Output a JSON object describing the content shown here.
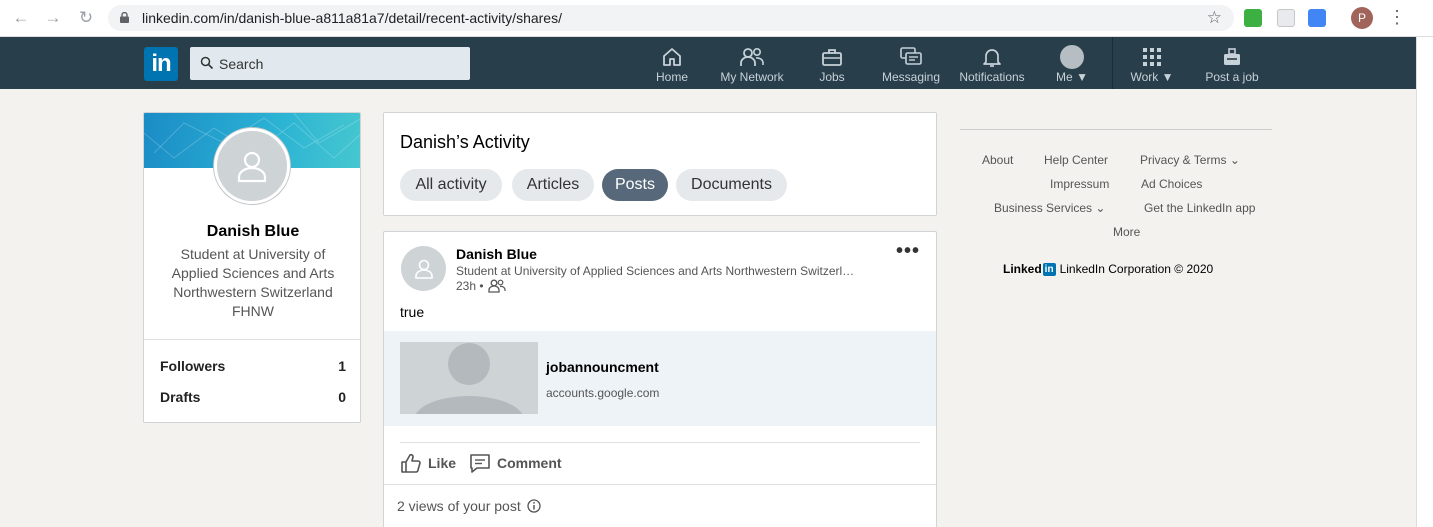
{
  "browser": {
    "url": "linkedin.com/in/danish-blue-a811a81a7/detail/recent-activity/shares/",
    "profile_initial": "P"
  },
  "header": {
    "logo": "in",
    "search_placeholder": "Search",
    "nav": [
      {
        "label": "Home",
        "icon": "home-icon"
      },
      {
        "label": "My Network",
        "icon": "network-icon"
      },
      {
        "label": "Jobs",
        "icon": "briefcase-icon"
      },
      {
        "label": "Messaging",
        "icon": "messaging-icon"
      },
      {
        "label": "Notifications",
        "icon": "bell-icon"
      },
      {
        "label": "Me",
        "icon": "avatar-icon"
      },
      {
        "label": "Work",
        "icon": "grid-icon"
      },
      {
        "label": "Post a job",
        "icon": "post-job-icon"
      }
    ]
  },
  "profile": {
    "name": "Danish Blue",
    "headline": "Student at University of Applied Sciences and Arts Northwestern Switzerland FHNW",
    "stats": [
      {
        "label": "Followers",
        "value": "1"
      },
      {
        "label": "Drafts",
        "value": "0"
      }
    ]
  },
  "activity": {
    "title": "Danish’s Activity",
    "tabs": [
      {
        "label": "All activity",
        "active": false
      },
      {
        "label": "Articles",
        "active": false
      },
      {
        "label": "Posts",
        "active": true
      },
      {
        "label": "Documents",
        "active": false
      }
    ]
  },
  "post": {
    "author": "Danish Blue",
    "headline": "Student at University of Applied Sciences and Arts Northwestern Switzerl…",
    "time": "23h •",
    "text": "true",
    "link": {
      "title": "jobannouncment",
      "source": "accounts.google.com"
    },
    "actions": {
      "like": "Like",
      "comment": "Comment"
    },
    "views": "2 views of your post"
  },
  "footer": {
    "links": {
      "about": "About",
      "help": "Help Center",
      "privacy": "Privacy & Terms",
      "impressum": "Impressum",
      "adchoices": "Ad Choices",
      "business": "Business Services",
      "app": "Get the LinkedIn app",
      "more": "More"
    },
    "brand": "Linked",
    "brand_in": "in",
    "copyright": "LinkedIn Corporation © 2020"
  },
  "colors": {
    "header_bg": "#283e4a",
    "brand_blue": "#0073b1",
    "active_pill": "#56687a"
  }
}
